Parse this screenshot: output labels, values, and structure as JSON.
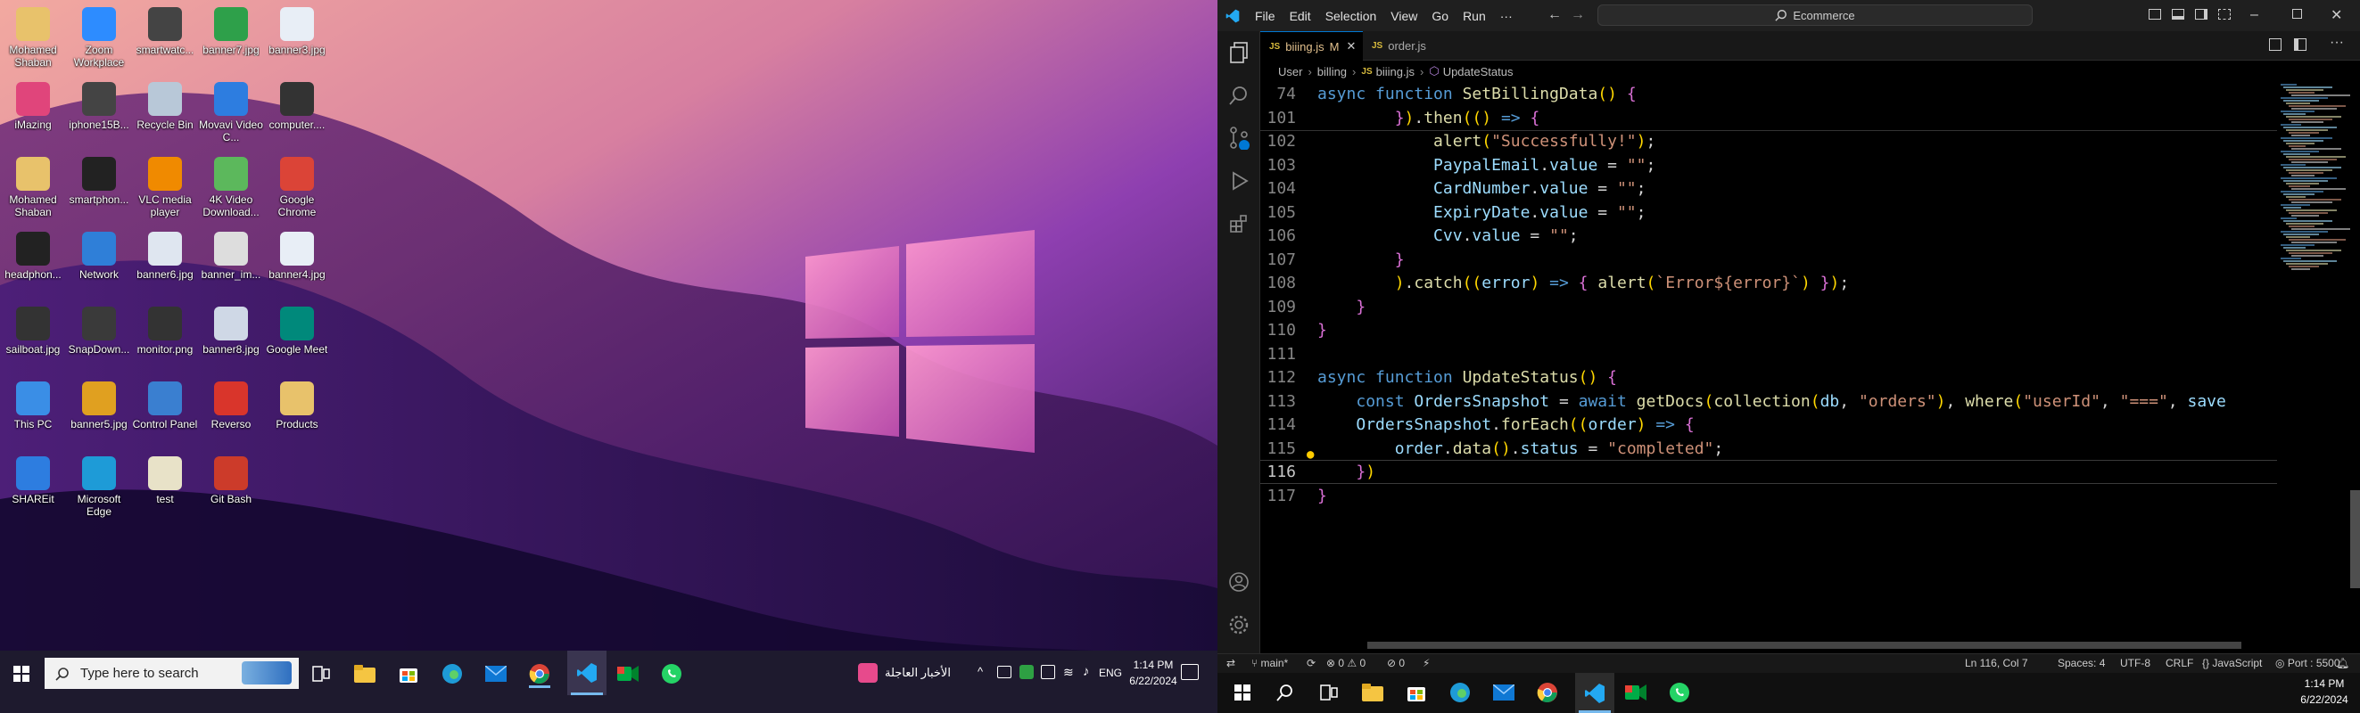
{
  "desktop": {
    "icons": [
      {
        "label": "Mohamed Shaban",
        "icon": "folder-user-icon",
        "color": "#e8c26b"
      },
      {
        "label": "iMazing",
        "icon": "imazing-icon",
        "color": "#e0457b"
      },
      {
        "label": "Mohamed Shaban",
        "icon": "file-icon",
        "color": "#e8c26b"
      },
      {
        "label": "headphon...",
        "icon": "headphones-icon",
        "color": "#222222"
      },
      {
        "label": "sailboat.jpg",
        "icon": "image-icon",
        "color": "#333333"
      },
      {
        "label": "This PC",
        "icon": "this-pc-icon",
        "color": "#3a8ee6"
      },
      {
        "label": "SHAREit",
        "icon": "shareit-icon",
        "color": "#2d7de0"
      },
      {
        "label": "Zoom Workplace",
        "icon": "zoom-icon",
        "color": "#2d8cff"
      },
      {
        "label": "iphone15B...",
        "icon": "image-icon",
        "color": "#444444"
      },
      {
        "label": "smartphon...",
        "icon": "phone-icon",
        "color": "#222222"
      },
      {
        "label": "Network",
        "icon": "network-icon",
        "color": "#2f7fd8"
      },
      {
        "label": "SnapDown...",
        "icon": "snapdown-icon",
        "color": "#3a3a3a"
      },
      {
        "label": "banner5.jpg",
        "icon": "image-icon",
        "color": "#e0a020"
      },
      {
        "label": "Microsoft Edge",
        "icon": "edge-icon",
        "color": "#1e9bd7"
      },
      {
        "label": "smartwatc...",
        "icon": "watch-icon",
        "color": "#444444"
      },
      {
        "label": "Recycle Bin",
        "icon": "recycle-bin-icon",
        "color": "#b8c8d8"
      },
      {
        "label": "VLC media player",
        "icon": "vlc-icon",
        "color": "#f08a00"
      },
      {
        "label": "banner6.jpg",
        "icon": "image-icon",
        "color": "#dfe6f0"
      },
      {
        "label": "monitor.png",
        "icon": "monitor-icon",
        "color": "#333333"
      },
      {
        "label": "Control Panel",
        "icon": "control-panel-icon",
        "color": "#3a7fd0"
      },
      {
        "label": "test",
        "icon": "file-icon",
        "color": "#e8e2c8"
      },
      {
        "label": "banner7.jpg",
        "icon": "image-icon",
        "color": "#2ea04a"
      },
      {
        "label": "Movavi Video C...",
        "icon": "movavi-icon",
        "color": "#2d7de0"
      },
      {
        "label": "4K Video Download...",
        "icon": "4k-video-icon",
        "color": "#5cb85c"
      },
      {
        "label": "banner_im...",
        "icon": "image-icon",
        "color": "#dddddd"
      },
      {
        "label": "banner8.jpg",
        "icon": "image-icon",
        "color": "#cfd8e6"
      },
      {
        "label": "Reverso",
        "icon": "reverso-icon",
        "color": "#d9352b"
      },
      {
        "label": "Git Bash",
        "icon": "git-bash-icon",
        "color": "#cc3b2a"
      },
      {
        "label": "banner3.jpg",
        "icon": "image-icon",
        "color": "#e8eef6"
      },
      {
        "label": "computer....",
        "icon": "computer-icon",
        "color": "#333333"
      },
      {
        "label": "Google Chrome",
        "icon": "chrome-icon",
        "color": "#db4437"
      },
      {
        "label": "banner4.jpg",
        "icon": "image-icon",
        "color": "#e8eef6"
      },
      {
        "label": "Google Meet",
        "icon": "google-meet-icon",
        "color": "#00897b"
      },
      {
        "label": "Products",
        "icon": "folder-icon",
        "color": "#e8c26b"
      }
    ]
  },
  "taskbar_left": {
    "search_placeholder": "Type here to search",
    "news_text": "الأخبار العاجلة",
    "lang": "ENG",
    "time": "1:14 PM",
    "date": "6/22/2024"
  },
  "vscode": {
    "menu": [
      "File",
      "Edit",
      "Selection",
      "View",
      "Go",
      "Run",
      "···"
    ],
    "search": "Ecommerce",
    "tabs": [
      {
        "label": "biiing.js",
        "modified": "M",
        "active": true
      },
      {
        "label": "order.js",
        "modified": "",
        "active": false
      }
    ],
    "breadcrumb": [
      "User",
      "billing",
      "biiing.js",
      "UpdateStatus"
    ],
    "status": {
      "branch": "main*",
      "errors": "0",
      "warnings": "0",
      "ports": "0",
      "position": "Ln 116, Col 7",
      "spaces": "Spaces: 4",
      "encoding": "UTF-8",
      "eol": "CRLF",
      "language": "JavaScript",
      "port": "Port : 5500"
    },
    "code_lines": [
      {
        "n": "74",
        "text": "async function SetBillingData() {"
      },
      {
        "n": "101",
        "text": "        }).then(() => {"
      },
      {
        "n": "102",
        "text": "            alert(\"Successfully!\");"
      },
      {
        "n": "103",
        "text": "            PaypalEmail.value = \"\";"
      },
      {
        "n": "104",
        "text": "            CardNumber.value = \"\";"
      },
      {
        "n": "105",
        "text": "            ExpiryDate.value = \"\";"
      },
      {
        "n": "106",
        "text": "            Cvv.value = \"\";"
      },
      {
        "n": "107",
        "text": "        }"
      },
      {
        "n": "108",
        "text": "        ).catch((error) => { alert(`Error${error}`) });"
      },
      {
        "n": "109",
        "text": "    }"
      },
      {
        "n": "110",
        "text": "}"
      },
      {
        "n": "111",
        "text": ""
      },
      {
        "n": "112",
        "text": "async function UpdateStatus() {"
      },
      {
        "n": "113",
        "text": "    const OrdersSnapshot = await getDocs(collection(db, \"orders\"), where(\"userId\", \"===\", save"
      },
      {
        "n": "114",
        "text": "    OrdersSnapshot.forEach((order) => {"
      },
      {
        "n": "115",
        "text": "        order.data().status = \"completed\";"
      },
      {
        "n": "116",
        "text": "    })"
      },
      {
        "n": "117",
        "text": "}"
      }
    ]
  },
  "taskbar_right": {
    "time": "1:14 PM",
    "date": "6/22/2024"
  }
}
